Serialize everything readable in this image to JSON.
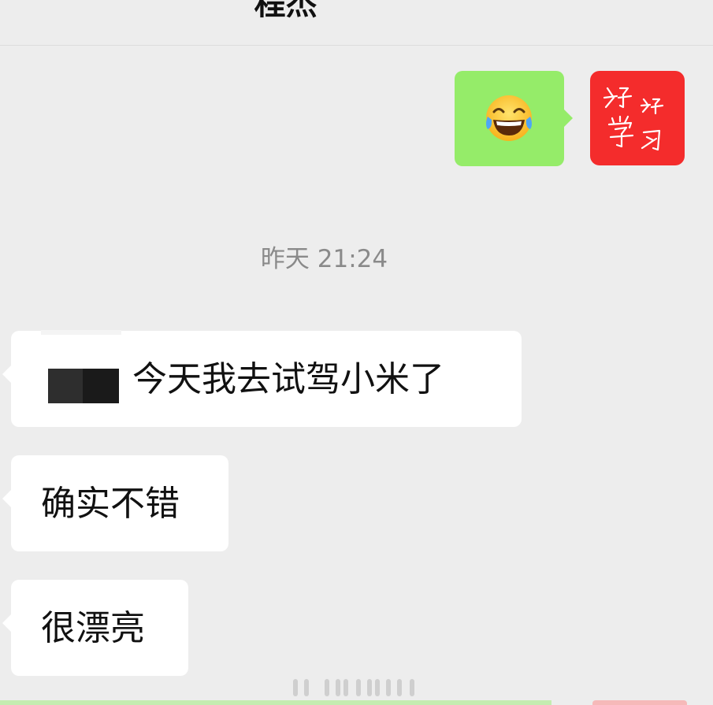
{
  "header": {
    "title": "程杰"
  },
  "messages": {
    "sent_emoji": {
      "emoji": "😂",
      "icon": "tears-of-joy-emoji-icon"
    },
    "sticker": {
      "lines": [
        "好",
        "好",
        "学",
        "习"
      ],
      "icon": "study-hard-sticker-icon",
      "color": "#f42c2c"
    },
    "timestamp": "昨天 21:24",
    "received": [
      {
        "text": "今天我去试驾小米了"
      },
      {
        "text": "确实不错"
      },
      {
        "text": "很漂亮"
      }
    ]
  },
  "colors": {
    "background": "#ededed",
    "sent_bubble": "#95ec69",
    "received_bubble": "#ffffff",
    "timestamp_text": "#8a8a8a"
  }
}
